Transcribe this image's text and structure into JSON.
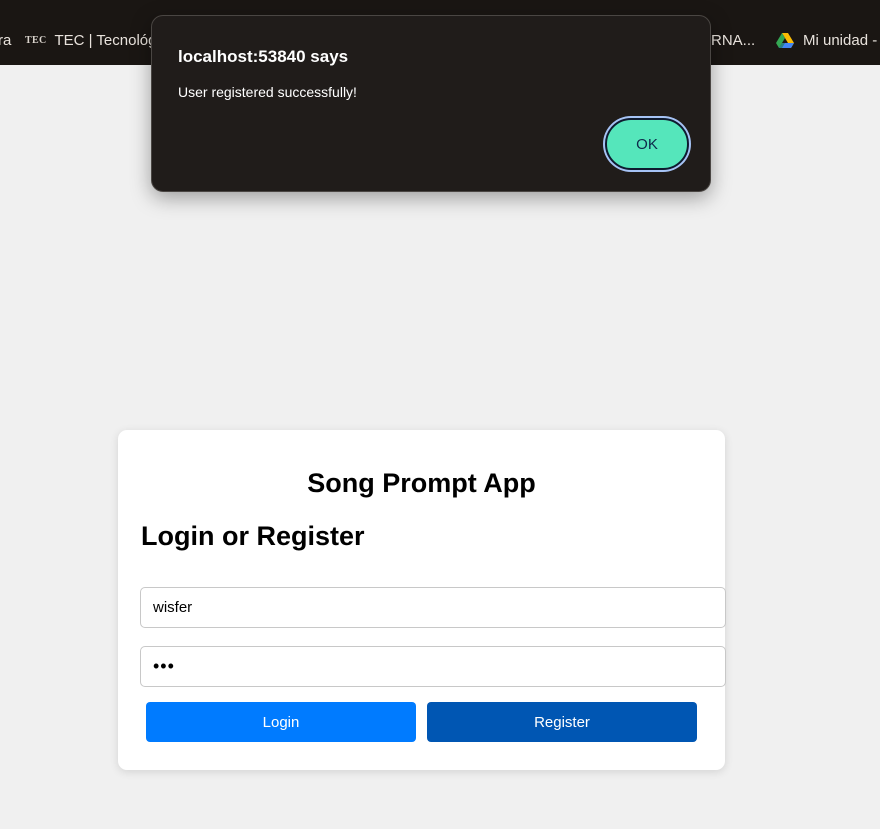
{
  "bookmarks": {
    "partial_left": "ra",
    "tec_icon": "TEC",
    "tec_label": "TEC | Tecnológi",
    "partial_mid": "RNA...",
    "drive_icon": "google-drive-icon",
    "drive_label": "Mi unidad -"
  },
  "dialog": {
    "title": "localhost:53840 says",
    "message": "User registered successfully!",
    "ok_label": "OK"
  },
  "app": {
    "title": "Song Prompt App",
    "section_title": "Login or Register",
    "username_value": "wisfer",
    "password_value": "•••",
    "login_label": "Login",
    "register_label": "Register"
  },
  "colors": {
    "login_button": "#007bff",
    "register_button": "#0056b3",
    "ok_button": "#55e6bb",
    "dialog_background": "#201c1a",
    "page_background": "#f0f0f0"
  }
}
